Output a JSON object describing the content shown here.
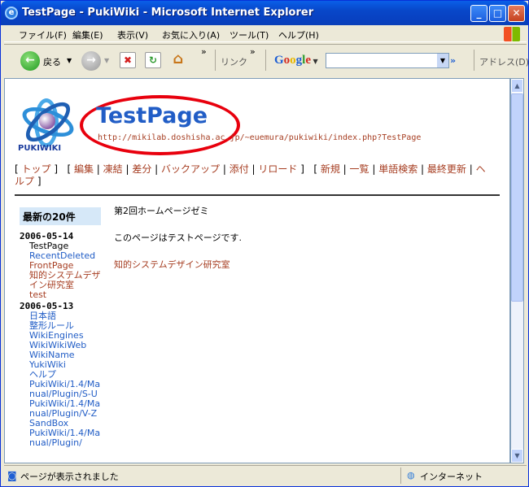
{
  "window": {
    "title": "TestPage - PukiWiki - Microsoft Internet Explorer"
  },
  "menubar": {
    "items": [
      "ファイル(F)",
      "編集(E)",
      "表示(V)",
      "お気に入り(A)",
      "ツール(T)",
      "ヘルプ(H)"
    ]
  },
  "toolbar": {
    "back_label": "戻る",
    "links_label": "リンク",
    "address_label": "アドレス(D)",
    "google_label": "Google",
    "search_value": ""
  },
  "page": {
    "title": "TestPage",
    "url": "http://mikilab.doshisha.ac.jp/~euemura/pukiwiki/index.php?TestPage",
    "logo_text": "PUKIWIKI",
    "nav": {
      "top": "トップ",
      "edit": "編集",
      "freeze": "凍結",
      "diff": "差分",
      "backup": "バックアップ",
      "attach": "添付",
      "reload": "リロード",
      "new": "新規",
      "list": "一覧",
      "search": "単語検索",
      "recent": "最終更新",
      "help": "ヘルプ"
    },
    "sidebar": {
      "heading": "最新の20件",
      "groups": [
        {
          "date": "2006-05-14",
          "items": [
            "TestPage",
            "RecentDeleted",
            "FrontPage",
            "知的システムデザイン研究室",
            "test"
          ]
        },
        {
          "date": "2006-05-13",
          "items": [
            "日本語",
            "整形ルール",
            "WikiEngines",
            "WikiWikiWeb",
            "WikiName",
            "YukiWiki",
            "ヘルプ",
            "PukiWiki/1.4/Manual/Plugin/S-U",
            "PukiWiki/1.4/Manual/Plugin/V-Z",
            "SandBox",
            "PukiWiki/1.4/Manual/Plugin/"
          ]
        }
      ]
    },
    "body": {
      "line1": "第2回ホームページゼミ",
      "line2": "このページはテストページです.",
      "link": "知的システムデザイン研究室"
    }
  },
  "status": {
    "text": "ページが表示されました",
    "zone": "インターネット"
  }
}
